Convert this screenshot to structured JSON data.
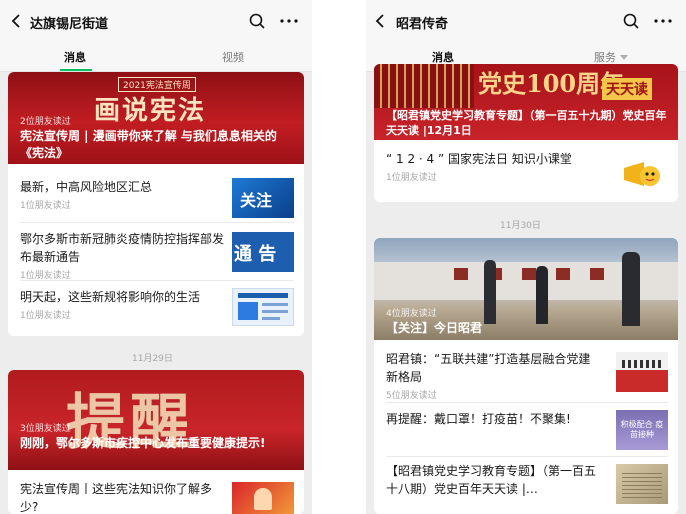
{
  "left": {
    "title": "达旗锡尼街道",
    "tabs": [
      "消息",
      "视频"
    ],
    "card1": {
      "banner_stamp": "2021宪法宣传周",
      "banner_big": "画说宪法",
      "read": "2位朋友读过",
      "title": "宪法宣传周 | 漫画带你来了解 与我们息息相关的《宪法》",
      "items": [
        {
          "title": "最新，中高风险地区汇总",
          "read": "1位朋友读过",
          "thumb_text": "关注"
        },
        {
          "title": "鄂尔多斯市新冠肺炎疫情防控指挥部发布最新通告",
          "read": "1位朋友读过",
          "thumb_text": "通 告"
        },
        {
          "title": "明天起，这些新规将影响你的生活",
          "read": "1位朋友读过",
          "thumb_text": ""
        }
      ]
    },
    "date2": "11月29日",
    "card2": {
      "banner_big": "提醒",
      "read": "3位朋友读过",
      "title": "刚刚，鄂尔多斯市疾控中心发布重要健康提示!",
      "items": [
        {
          "title": "宪法宣传周丨这些宪法知识你了解多少?",
          "read": ""
        }
      ]
    }
  },
  "right": {
    "title": "昭君传奇",
    "tabs": [
      "消息",
      "服务"
    ],
    "card1": {
      "banner_big": "党史100周年",
      "banner_badge": "天天读",
      "banner_title": "【昭君镇党史学习教育专题】（第一百五十九期）党史百年天天读 |12月1日",
      "items": [
        {
          "title": "“ 1 2 · 4 ” 国家宪法日 知识小课堂",
          "read": "1位朋友读过"
        }
      ]
    },
    "date2": "11月30日",
    "card2": {
      "read": "4位朋友读过",
      "title": "【关注】今日昭君",
      "items": [
        {
          "title": "昭君镇：“五联共建”打造基层融合党建新格局",
          "read": "5位朋友读过"
        },
        {
          "title": "再提醒：戴口罩！打疫苗！不聚集!",
          "read": "",
          "thumb_text": "积极配合 疫苗接种"
        },
        {
          "title": "【昭君镇党史学习教育专题】（第一百五十八期）党史百年天天读 |…",
          "read": ""
        }
      ]
    }
  },
  "colors": {
    "accent": "#07c160",
    "banner_red": "#b3161b",
    "bg": "#ededed"
  }
}
